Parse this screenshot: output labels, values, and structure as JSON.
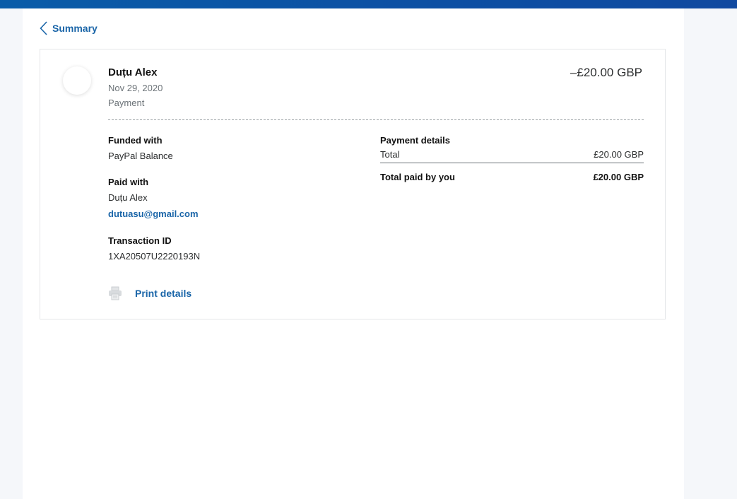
{
  "back": {
    "label": "Summary"
  },
  "transaction": {
    "name": "Duțu Alex",
    "date": "Nov 29, 2020",
    "type": "Payment",
    "amount": "–£20.00 GBP"
  },
  "funded_with": {
    "label": "Funded with",
    "value": "PayPal Balance"
  },
  "paid_with": {
    "label": "Paid with",
    "name": "Duțu Alex",
    "email": "dutuasu@gmail.com"
  },
  "transaction_id": {
    "label": "Transaction ID",
    "value": "1XA20507U2220193N"
  },
  "payment_details": {
    "label": "Payment details",
    "total_label": "Total",
    "total_value": "£20.00 GBP",
    "paid_label": "Total paid by you",
    "paid_value": "£20.00 GBP"
  },
  "print": {
    "label": "Print details",
    "icon": "printer-icon"
  },
  "colors": {
    "accent": "#1a65a8",
    "topbar": "#0c4fa3"
  }
}
